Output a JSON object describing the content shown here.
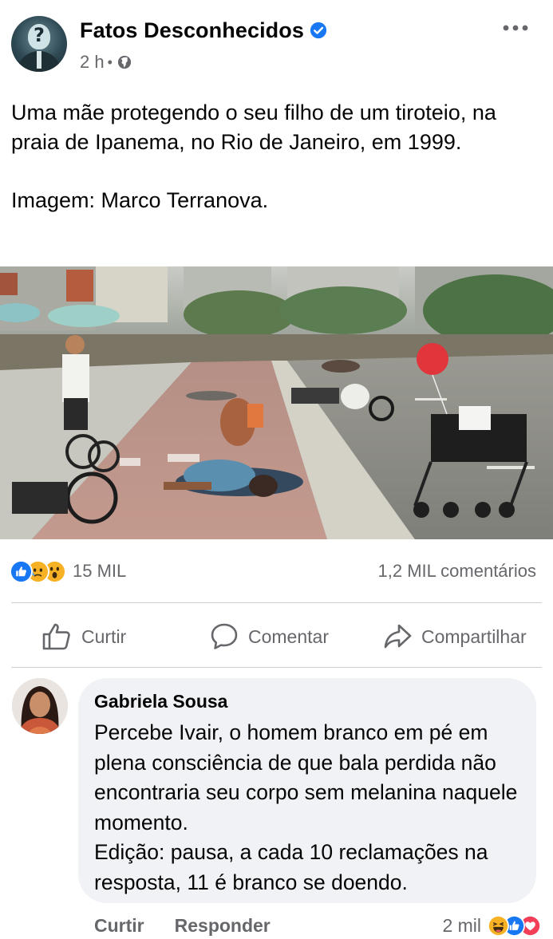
{
  "post": {
    "page_name": "Fatos Desconhecidos",
    "verified_icon": "verified-badge-icon",
    "time": "2 h",
    "separator": "•",
    "audience_icon": "globe-icon",
    "more_icon": "more-options-icon",
    "text_lines": [
      "Uma mãe protegendo o seu filho de um tiroteio, na praia de Ipanema, no Rio de Janeiro, em 1999.",
      "Imagem: Marco Terranova."
    ]
  },
  "stats": {
    "reactions": [
      "like-reaction-icon",
      "care-reaction-icon",
      "wow-reaction-icon"
    ],
    "reaction_count": "15 MIL",
    "comments": "1,2 MIL comentários"
  },
  "actions": {
    "like": "Curtir",
    "comment": "Comentar",
    "share": "Compartilhar"
  },
  "comment": {
    "author": "Gabriela Sousa",
    "lines": [
      "Percebe Ivair, o homem branco em pé em plena consciência de que bala perdida não encontraria seu corpo sem melanina naquele momento.",
      "Edição: pausa, a cada 10 reclamações na resposta, 11 é branco se doendo."
    ],
    "like_label": "Curtir",
    "reply_label": "Responder",
    "reaction_count": "2 mil",
    "reactions": [
      "haha-reaction-icon",
      "like-reaction-icon",
      "love-reaction-icon"
    ]
  },
  "colors": {
    "brand_blue": "#1877f2",
    "secondary_text": "#65676b",
    "bubble_bg": "#f0f2f5",
    "love_red": "#f33e58",
    "reaction_yellow": "#f7b125"
  }
}
